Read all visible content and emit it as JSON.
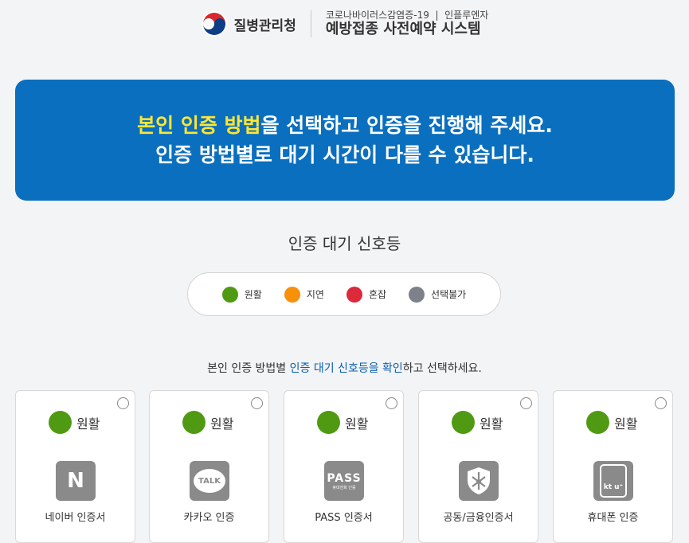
{
  "header": {
    "org_name": "질병관리청",
    "system_sub": "코로나바이러스감염증-19  |  인플루엔자",
    "system_title": "예방접종 사전예약 시스템"
  },
  "banner": {
    "line1_highlight": "본인 인증 방법",
    "line1_rest": "을 선택하고 인증을 진행해 주세요.",
    "line2": "인증 방법별로 대기 시간이 다를 수 있습니다."
  },
  "signal": {
    "title": "인증 대기 신호등",
    "legend": [
      {
        "label": "원활",
        "color": "#4f9a12"
      },
      {
        "label": "지연",
        "color": "#f7900a"
      },
      {
        "label": "혼잡",
        "color": "#dc2a3b"
      },
      {
        "label": "선택불가",
        "color": "#7d818a"
      }
    ]
  },
  "instruction": {
    "prefix": "본인 인증 방법별 ",
    "emphasis": "인증 대기 신호등을 확인",
    "suffix": "하고 선택하세요."
  },
  "methods": [
    {
      "status": "원활",
      "label": "네이버 인증서",
      "icon": "naver-icon",
      "icon_text": "N"
    },
    {
      "status": "원활",
      "label": "카카오 인증",
      "icon": "kakao-talk-icon",
      "icon_text": "TALK"
    },
    {
      "status": "원활",
      "label": "PASS 인증서",
      "icon": "pass-icon",
      "icon_text": "PASS",
      "icon_subtext": "휴대전화 인증"
    },
    {
      "status": "원활",
      "label": "공동/금융인증서",
      "icon": "certificate-shield-icon"
    },
    {
      "status": "원활",
      "label": "휴대폰 인증",
      "icon": "mobile-phone-icon",
      "icon_text": "kt u⁺"
    }
  ],
  "colors": {
    "banner_bg": "#0a6fbf",
    "highlight": "#ffe633",
    "status_ok": "#4f9a12",
    "accent_text": "#0a5fb0"
  }
}
